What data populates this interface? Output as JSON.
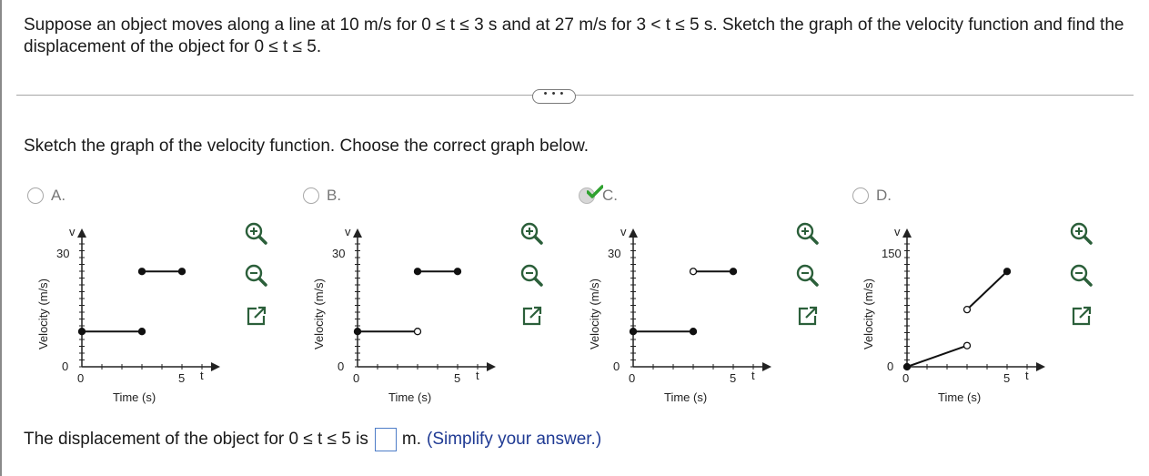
{
  "question": {
    "text": "Suppose an object moves along a line at 10 m/s for 0 ≤ t ≤ 3 s and at 27 m/s for 3 < t ≤ 5 s. Sketch the graph of the velocity function and find the displacement of the object for 0 ≤ t ≤ 5."
  },
  "more_button": "• • •",
  "prompt": "Sketch the graph of the velocity function. Choose the correct graph below.",
  "options": [
    {
      "letter": "A.",
      "selected": false
    },
    {
      "letter": "B.",
      "selected": false
    },
    {
      "letter": "C.",
      "selected": true,
      "correct": true
    },
    {
      "letter": "D.",
      "selected": false
    }
  ],
  "graphs": {
    "ylabel": "Velocity (m/s)",
    "xlabel": "Time (s)",
    "v_label": "v",
    "t_label": "t",
    "x0": "0",
    "x5": "5",
    "y0": "0",
    "y30": "30",
    "y150": "150"
  },
  "answer": {
    "prefix": "The displacement of the object for 0 ≤ t ≤ 5 is",
    "value": "",
    "unit": "m.",
    "hint": "(Simplify your answer.)"
  },
  "colors": {
    "accent": "#1f3a93",
    "check": "#2fa12f",
    "input_border": "#4d7cc7"
  },
  "icons": [
    "zoom-in-icon",
    "zoom-out-icon",
    "expand-icon",
    "checkmark-icon",
    "ellipsis-icon"
  ]
}
